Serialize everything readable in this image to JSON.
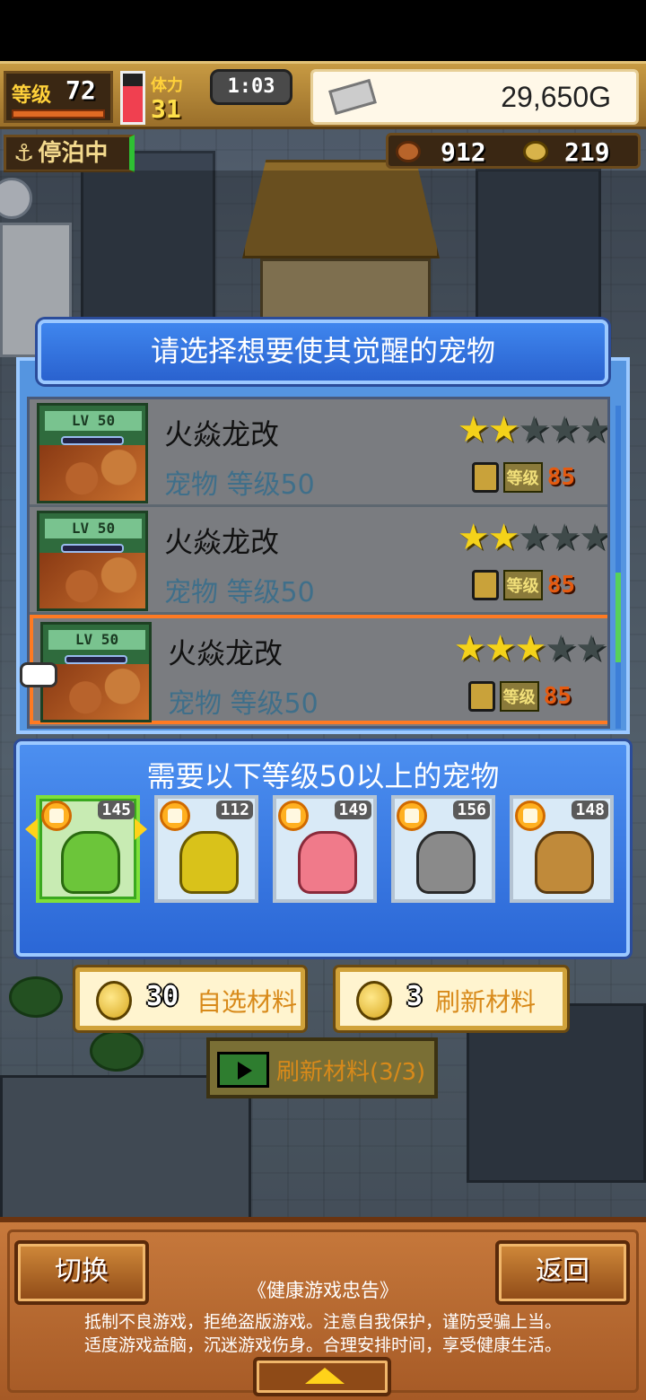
{
  "hud": {
    "level_label": "等级",
    "level": "72",
    "stamina_label": "体力",
    "stamina": "31",
    "timer": "1:03",
    "gold": "29,650G",
    "status": "停泊中",
    "resource_food": "912",
    "resource_coin": "219"
  },
  "pet_dialog": {
    "title": "请选择想要使其觉醒的宠物",
    "pets": [
      {
        "lv_tag": "LV 50",
        "name": "火焱龙改",
        "sub": "宠物 等级50",
        "stars": 2,
        "max_stars": 5,
        "lock_label": "等级",
        "lock_level": "85",
        "selected": false
      },
      {
        "lv_tag": "LV 50",
        "name": "火焱龙改",
        "sub": "宠物 等级50",
        "stars": 2,
        "max_stars": 5,
        "lock_label": "等级",
        "lock_level": "85",
        "selected": false
      },
      {
        "lv_tag": "LV 50",
        "name": "火焱龙改",
        "sub": "宠物 等级50",
        "stars": 3,
        "max_stars": 5,
        "lock_label": "等级",
        "lock_level": "85",
        "selected": true
      }
    ]
  },
  "material_dialog": {
    "title": "需要以下等级50以上的宠物",
    "materials": [
      {
        "level": "145",
        "color": "#6cc53a"
      },
      {
        "level": "112",
        "color": "#d9c21a"
      },
      {
        "level": "149",
        "color": "#f07a8a"
      },
      {
        "level": "156",
        "color": "#8a8a8a"
      },
      {
        "level": "148",
        "color": "#c08a3a"
      }
    ]
  },
  "actions": {
    "choose_count": "30",
    "choose_label": "自选材料",
    "refresh_count": "3",
    "refresh_label": "刷新材料",
    "video_label": "刷新材料(3/3)"
  },
  "bottom": {
    "switch_label": "切换",
    "back_label": "返回",
    "notice_title": "《健康游戏忠告》",
    "notice_line1": "抵制不良游戏，拒绝盗版游戏。注意自我保护，谨防受骗上当。",
    "notice_line2": "适度游戏益脑，沉迷游戏伤身。合理安排时间，享受健康生活。"
  }
}
